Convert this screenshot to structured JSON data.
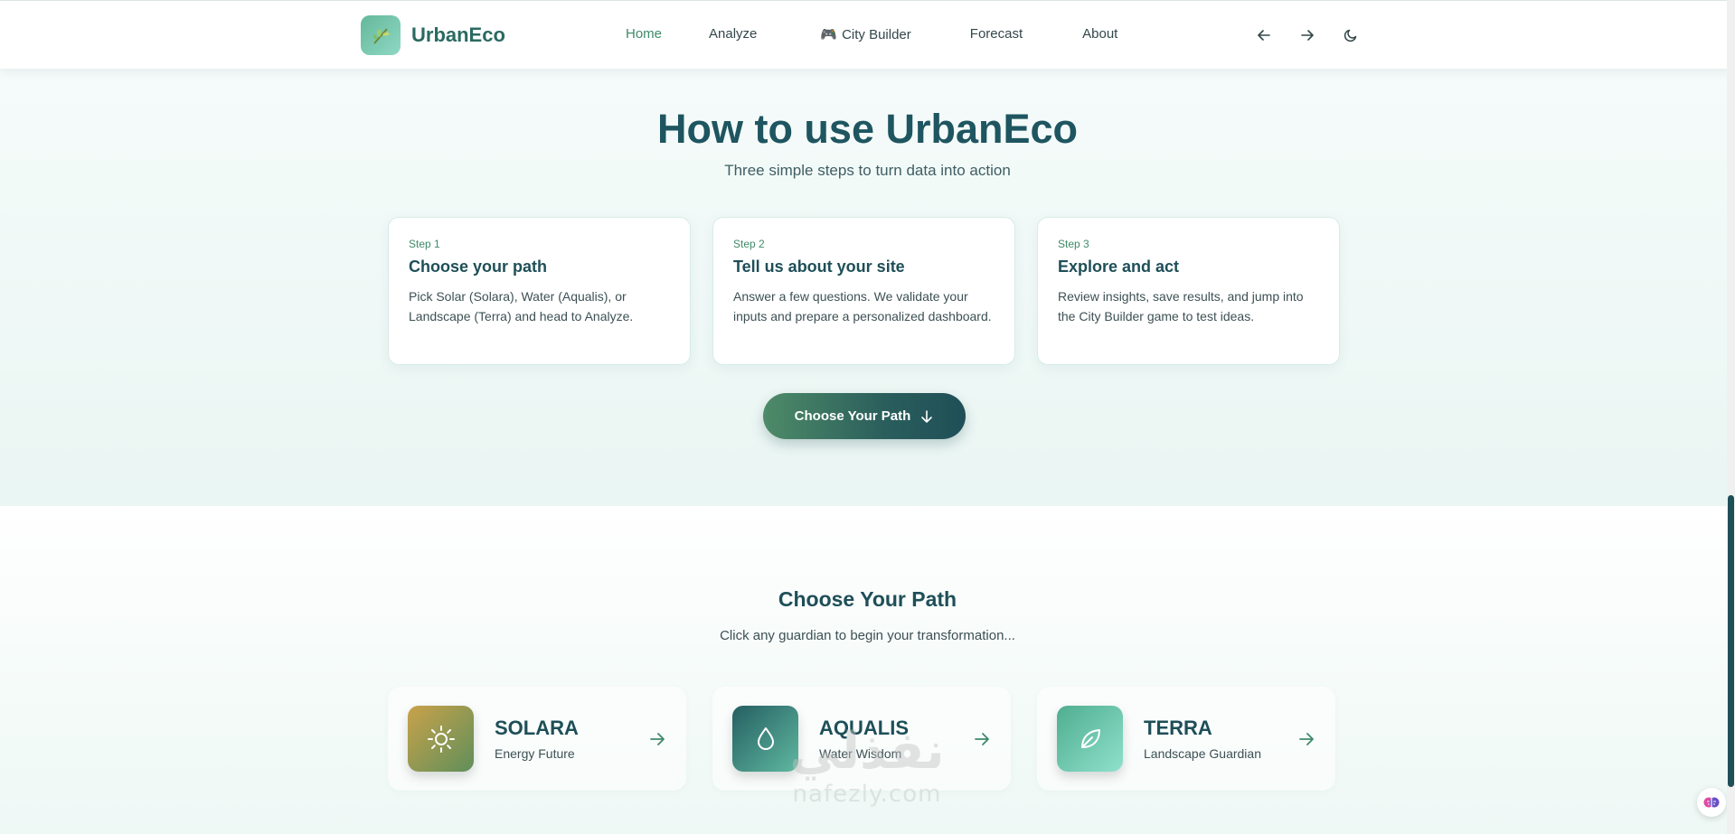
{
  "nav": {
    "brand": "UrbanEco",
    "links": [
      "Home",
      "Analyze",
      "City Builder",
      "Forecast",
      "About"
    ],
    "active": "Home"
  },
  "hero": {
    "title": "How to use UrbanEco",
    "subtitle": "Three simple steps to turn data into action",
    "steps": [
      {
        "label": "Step 1",
        "title": "Choose your path",
        "text": "Pick Solar (Solara), Water (Aqualis), or Landscape (Terra) and head to Analyze."
      },
      {
        "label": "Step 2",
        "title": "Tell us about your site",
        "text": "Answer a few questions. We validate your inputs and prepare a personalized dashboard."
      },
      {
        "label": "Step 3",
        "title": "Explore and act",
        "text": "Review insights, save results, and jump into the City Builder game to test ideas."
      }
    ],
    "cta": "Choose Your Path"
  },
  "paths": {
    "title": "Choose Your Path",
    "subtitle": "Click any guardian to begin your transformation...",
    "cards": [
      {
        "name": "SOLARA",
        "desc": "Energy Future",
        "icon": "sun-icon"
      },
      {
        "name": "AQUALIS",
        "desc": "Water Wisdom",
        "icon": "droplet-icon"
      },
      {
        "name": "TERRA",
        "desc": "Landscape Guardian",
        "icon": "leaf-icon"
      }
    ]
  },
  "watermark": {
    "arabic": "نفذلي",
    "latin": "nafezly.com"
  },
  "colors": {
    "primary_dark": "#1f4f57",
    "accent_green": "#3d8a69",
    "solara_gradient": [
      "#c9a24a",
      "#5f8f5a"
    ],
    "aqualis_gradient": [
      "#2a6a6a",
      "#5fb8a0"
    ],
    "terra_gradient": [
      "#4fae8f",
      "#8fe0cc"
    ]
  }
}
